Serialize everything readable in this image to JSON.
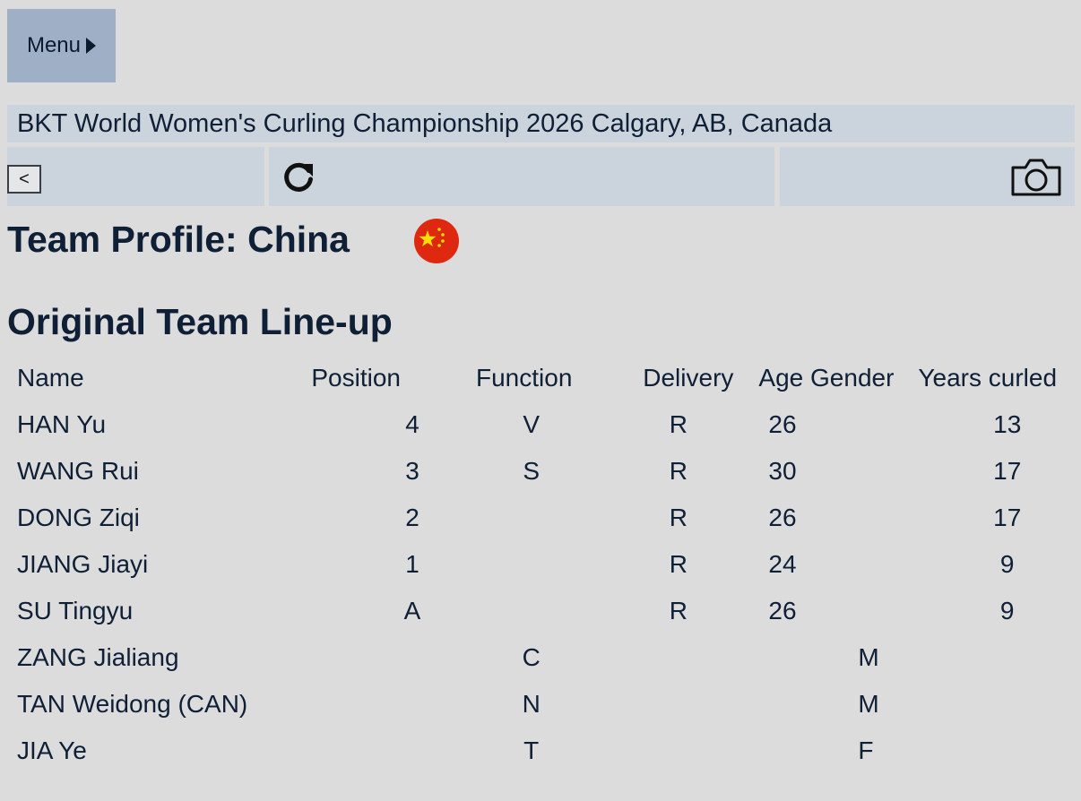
{
  "menu": {
    "label": "Menu"
  },
  "event": {
    "title": "BKT World Women's Curling Championship 2026 Calgary, AB, Canada"
  },
  "toolbar": {
    "back_label": "<",
    "refresh_icon": "refresh-icon",
    "camera_icon": "camera-icon"
  },
  "team": {
    "title": "Team Profile: China",
    "flag_icon": "china-flag-icon",
    "flag_colors": {
      "red": "#de2910",
      "star": "#ffde00"
    }
  },
  "lineup": {
    "title": "Original Team Line-up",
    "columns": [
      "Name",
      "Position",
      "Function",
      "Delivery",
      "Age",
      "Gender",
      "Years curled"
    ],
    "rows": [
      [
        "HAN Yu",
        "4",
        "V",
        "R",
        "26",
        "",
        "13"
      ],
      [
        "WANG Rui",
        "3",
        "S",
        "R",
        "30",
        "",
        "17"
      ],
      [
        "DONG Ziqi",
        "2",
        "",
        "R",
        "26",
        "",
        "17"
      ],
      [
        "JIANG Jiayi",
        "1",
        "",
        "R",
        "24",
        "",
        "9"
      ],
      [
        "SU Tingyu",
        "A",
        "",
        "R",
        "26",
        "",
        "9"
      ],
      [
        "ZANG Jialiang",
        "",
        "C",
        "",
        "",
        "M",
        ""
      ],
      [
        "TAN Weidong (CAN)",
        "",
        "N",
        "",
        "",
        "M",
        ""
      ],
      [
        "JIA Ye",
        "",
        "T",
        "",
        "",
        "F",
        ""
      ]
    ]
  }
}
